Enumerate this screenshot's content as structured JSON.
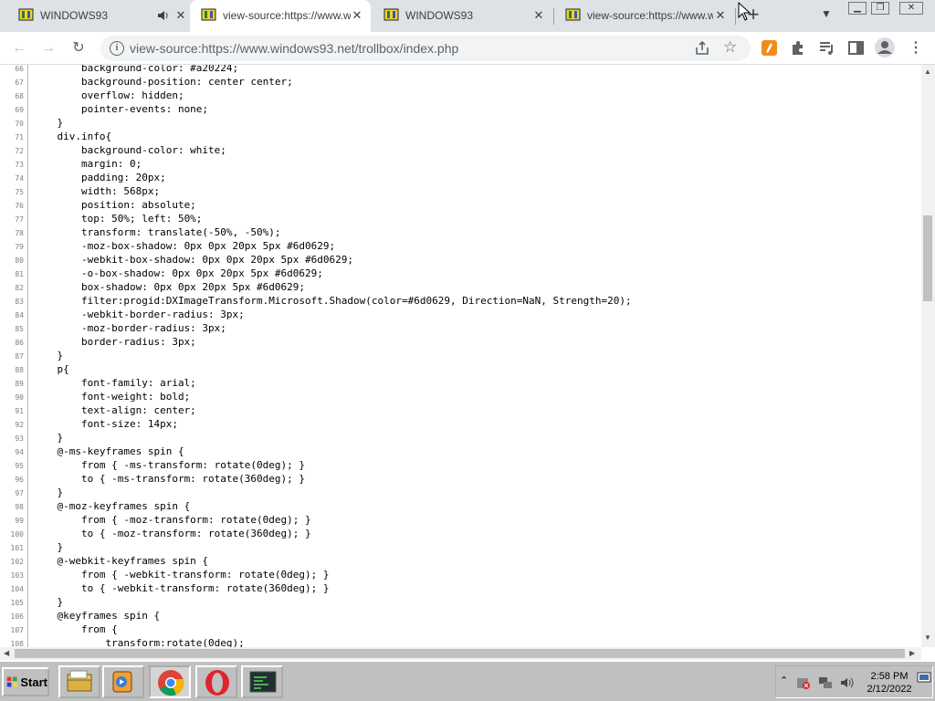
{
  "browser": {
    "tabs": [
      {
        "label": "WINDOWS93",
        "active": false
      },
      {
        "label": "view-source:https://www.w",
        "active": true
      },
      {
        "label": "WINDOWS93",
        "active": false
      },
      {
        "label": "view-source:https://www.w",
        "active": false
      }
    ],
    "url": "view-source:https://www.windows93.net/trollbox/index.php"
  },
  "source": {
    "lines": [
      {
        "n": "66",
        "code": "        background-color: #a20224;"
      },
      {
        "n": "67",
        "code": "        background-position: center center;"
      },
      {
        "n": "68",
        "code": "        overflow: hidden;"
      },
      {
        "n": "69",
        "code": "        pointer-events: none;"
      },
      {
        "n": "70",
        "code": "    }"
      },
      {
        "n": "71",
        "code": "    div.info{"
      },
      {
        "n": "72",
        "code": "        background-color: white;"
      },
      {
        "n": "73",
        "code": "        margin: 0;"
      },
      {
        "n": "74",
        "code": "        padding: 20px;"
      },
      {
        "n": "75",
        "code": "        width: 568px;"
      },
      {
        "n": "76",
        "code": "        position: absolute;"
      },
      {
        "n": "77",
        "code": "        top: 50%; left: 50%;"
      },
      {
        "n": "78",
        "code": "        transform: translate(-50%, -50%);"
      },
      {
        "n": "79",
        "code": "        -moz-box-shadow: 0px 0px 20px 5px #6d0629;"
      },
      {
        "n": "80",
        "code": "        -webkit-box-shadow: 0px 0px 20px 5px #6d0629;"
      },
      {
        "n": "81",
        "code": "        -o-box-shadow: 0px 0px 20px 5px #6d0629;"
      },
      {
        "n": "82",
        "code": "        box-shadow: 0px 0px 20px 5px #6d0629;"
      },
      {
        "n": "83",
        "code": "        filter:progid:DXImageTransform.Microsoft.Shadow(color=#6d0629, Direction=NaN, Strength=20);"
      },
      {
        "n": "84",
        "code": "        -webkit-border-radius: 3px;"
      },
      {
        "n": "85",
        "code": "        -moz-border-radius: 3px;"
      },
      {
        "n": "86",
        "code": "        border-radius: 3px;"
      },
      {
        "n": "87",
        "code": "    }"
      },
      {
        "n": "88",
        "code": "    p{"
      },
      {
        "n": "89",
        "code": "        font-family: arial;"
      },
      {
        "n": "90",
        "code": "        font-weight: bold;"
      },
      {
        "n": "91",
        "code": "        text-align: center;"
      },
      {
        "n": "92",
        "code": "        font-size: 14px;"
      },
      {
        "n": "93",
        "code": "    }"
      },
      {
        "n": "94",
        "code": "    @-ms-keyframes spin {"
      },
      {
        "n": "95",
        "code": "        from { -ms-transform: rotate(0deg); }"
      },
      {
        "n": "96",
        "code": "        to { -ms-transform: rotate(360deg); }"
      },
      {
        "n": "97",
        "code": "    }"
      },
      {
        "n": "98",
        "code": "    @-moz-keyframes spin {"
      },
      {
        "n": "99",
        "code": "        from { -moz-transform: rotate(0deg); }"
      },
      {
        "n": "100",
        "code": "        to { -moz-transform: rotate(360deg); }"
      },
      {
        "n": "101",
        "code": "    }"
      },
      {
        "n": "102",
        "code": "    @-webkit-keyframes spin {"
      },
      {
        "n": "103",
        "code": "        from { -webkit-transform: rotate(0deg); }"
      },
      {
        "n": "104",
        "code": "        to { -webkit-transform: rotate(360deg); }"
      },
      {
        "n": "105",
        "code": "    }"
      },
      {
        "n": "106",
        "code": "    @keyframes spin {"
      },
      {
        "n": "107",
        "code": "        from {"
      },
      {
        "n": "108",
        "code": "            transform:rotate(0deg);"
      }
    ]
  },
  "taskbar": {
    "start_label": "Start",
    "apps": [
      "file-manager-icon",
      "media-player-icon",
      "chrome-icon",
      "opera-icon",
      "terminal-icon"
    ],
    "clock_time": "2:58 PM",
    "clock_date": "2/12/2022"
  }
}
